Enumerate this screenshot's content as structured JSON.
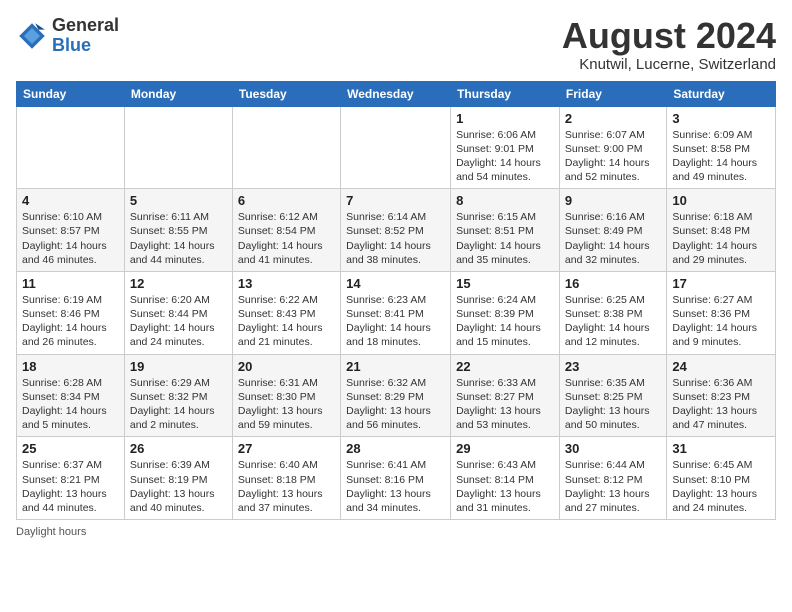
{
  "header": {
    "logo_general": "General",
    "logo_blue": "Blue",
    "title": "August 2024",
    "subtitle": "Knutwil, Lucerne, Switzerland"
  },
  "days_of_week": [
    "Sunday",
    "Monday",
    "Tuesday",
    "Wednesday",
    "Thursday",
    "Friday",
    "Saturday"
  ],
  "weeks": [
    [
      {
        "day": "",
        "info": ""
      },
      {
        "day": "",
        "info": ""
      },
      {
        "day": "",
        "info": ""
      },
      {
        "day": "",
        "info": ""
      },
      {
        "day": "1",
        "info": "Sunrise: 6:06 AM\nSunset: 9:01 PM\nDaylight: 14 hours and 54 minutes."
      },
      {
        "day": "2",
        "info": "Sunrise: 6:07 AM\nSunset: 9:00 PM\nDaylight: 14 hours and 52 minutes."
      },
      {
        "day": "3",
        "info": "Sunrise: 6:09 AM\nSunset: 8:58 PM\nDaylight: 14 hours and 49 minutes."
      }
    ],
    [
      {
        "day": "4",
        "info": "Sunrise: 6:10 AM\nSunset: 8:57 PM\nDaylight: 14 hours and 46 minutes."
      },
      {
        "day": "5",
        "info": "Sunrise: 6:11 AM\nSunset: 8:55 PM\nDaylight: 14 hours and 44 minutes."
      },
      {
        "day": "6",
        "info": "Sunrise: 6:12 AM\nSunset: 8:54 PM\nDaylight: 14 hours and 41 minutes."
      },
      {
        "day": "7",
        "info": "Sunrise: 6:14 AM\nSunset: 8:52 PM\nDaylight: 14 hours and 38 minutes."
      },
      {
        "day": "8",
        "info": "Sunrise: 6:15 AM\nSunset: 8:51 PM\nDaylight: 14 hours and 35 minutes."
      },
      {
        "day": "9",
        "info": "Sunrise: 6:16 AM\nSunset: 8:49 PM\nDaylight: 14 hours and 32 minutes."
      },
      {
        "day": "10",
        "info": "Sunrise: 6:18 AM\nSunset: 8:48 PM\nDaylight: 14 hours and 29 minutes."
      }
    ],
    [
      {
        "day": "11",
        "info": "Sunrise: 6:19 AM\nSunset: 8:46 PM\nDaylight: 14 hours and 26 minutes."
      },
      {
        "day": "12",
        "info": "Sunrise: 6:20 AM\nSunset: 8:44 PM\nDaylight: 14 hours and 24 minutes."
      },
      {
        "day": "13",
        "info": "Sunrise: 6:22 AM\nSunset: 8:43 PM\nDaylight: 14 hours and 21 minutes."
      },
      {
        "day": "14",
        "info": "Sunrise: 6:23 AM\nSunset: 8:41 PM\nDaylight: 14 hours and 18 minutes."
      },
      {
        "day": "15",
        "info": "Sunrise: 6:24 AM\nSunset: 8:39 PM\nDaylight: 14 hours and 15 minutes."
      },
      {
        "day": "16",
        "info": "Sunrise: 6:25 AM\nSunset: 8:38 PM\nDaylight: 14 hours and 12 minutes."
      },
      {
        "day": "17",
        "info": "Sunrise: 6:27 AM\nSunset: 8:36 PM\nDaylight: 14 hours and 9 minutes."
      }
    ],
    [
      {
        "day": "18",
        "info": "Sunrise: 6:28 AM\nSunset: 8:34 PM\nDaylight: 14 hours and 5 minutes."
      },
      {
        "day": "19",
        "info": "Sunrise: 6:29 AM\nSunset: 8:32 PM\nDaylight: 14 hours and 2 minutes."
      },
      {
        "day": "20",
        "info": "Sunrise: 6:31 AM\nSunset: 8:30 PM\nDaylight: 13 hours and 59 minutes."
      },
      {
        "day": "21",
        "info": "Sunrise: 6:32 AM\nSunset: 8:29 PM\nDaylight: 13 hours and 56 minutes."
      },
      {
        "day": "22",
        "info": "Sunrise: 6:33 AM\nSunset: 8:27 PM\nDaylight: 13 hours and 53 minutes."
      },
      {
        "day": "23",
        "info": "Sunrise: 6:35 AM\nSunset: 8:25 PM\nDaylight: 13 hours and 50 minutes."
      },
      {
        "day": "24",
        "info": "Sunrise: 6:36 AM\nSunset: 8:23 PM\nDaylight: 13 hours and 47 minutes."
      }
    ],
    [
      {
        "day": "25",
        "info": "Sunrise: 6:37 AM\nSunset: 8:21 PM\nDaylight: 13 hours and 44 minutes."
      },
      {
        "day": "26",
        "info": "Sunrise: 6:39 AM\nSunset: 8:19 PM\nDaylight: 13 hours and 40 minutes."
      },
      {
        "day": "27",
        "info": "Sunrise: 6:40 AM\nSunset: 8:18 PM\nDaylight: 13 hours and 37 minutes."
      },
      {
        "day": "28",
        "info": "Sunrise: 6:41 AM\nSunset: 8:16 PM\nDaylight: 13 hours and 34 minutes."
      },
      {
        "day": "29",
        "info": "Sunrise: 6:43 AM\nSunset: 8:14 PM\nDaylight: 13 hours and 31 minutes."
      },
      {
        "day": "30",
        "info": "Sunrise: 6:44 AM\nSunset: 8:12 PM\nDaylight: 13 hours and 27 minutes."
      },
      {
        "day": "31",
        "info": "Sunrise: 6:45 AM\nSunset: 8:10 PM\nDaylight: 13 hours and 24 minutes."
      }
    ]
  ],
  "footer": "Daylight hours"
}
